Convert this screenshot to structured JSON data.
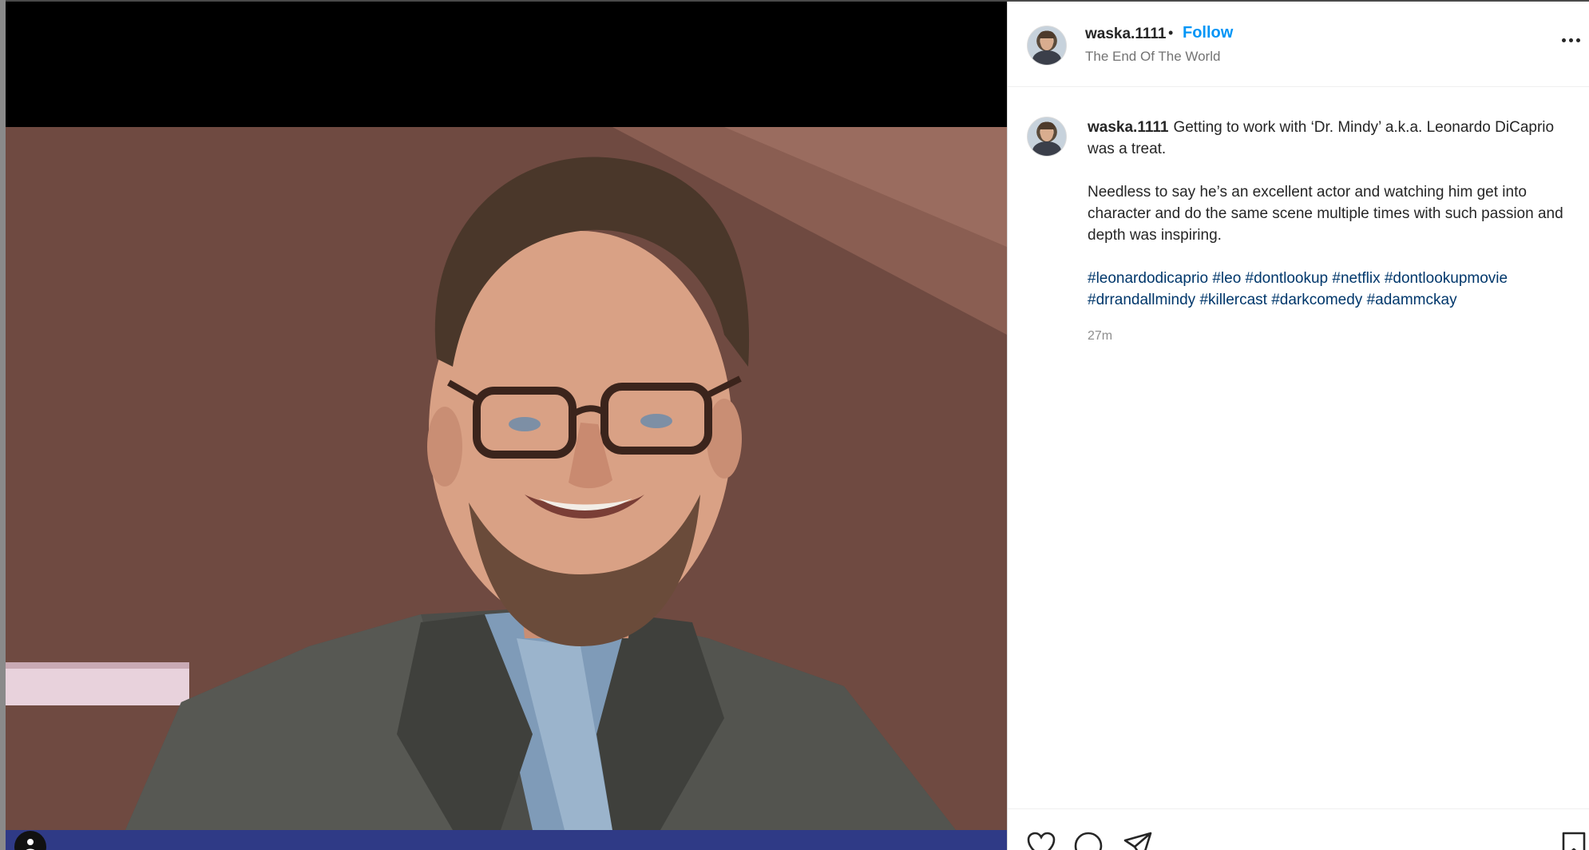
{
  "post": {
    "author": {
      "username": "waska.1111",
      "location": "The End Of The World"
    },
    "header": {
      "separator": "•",
      "follow_label": "Follow"
    },
    "caption": {
      "username": "waska.1111",
      "line1": "Getting to work with ‘Dr. Mindy’ a.k.a. Leonardo DiCaprio was a treat.",
      "line2": "Needless to say he’s an excellent actor and watching him get into character and do the same scene multiple times with such passion and depth was inspiring.",
      "hashtags": [
        "#leonardodicaprio",
        "#leo",
        "#dontlookup",
        "#netflix",
        "#dontlookupmovie",
        "#drrandallmindy",
        "#killercast",
        "#darkcomedy",
        "#adammckay"
      ],
      "time_ago": "27m"
    },
    "actions": {
      "like_icon": "heart-icon",
      "comment_icon": "comment-icon",
      "share_icon": "paper-plane-icon",
      "save_icon": "bookmark-icon"
    }
  },
  "colors": {
    "follow_blue": "#0095f6",
    "hashtag_blue": "#00376b",
    "text_primary": "#262626",
    "text_secondary": "#737373"
  }
}
